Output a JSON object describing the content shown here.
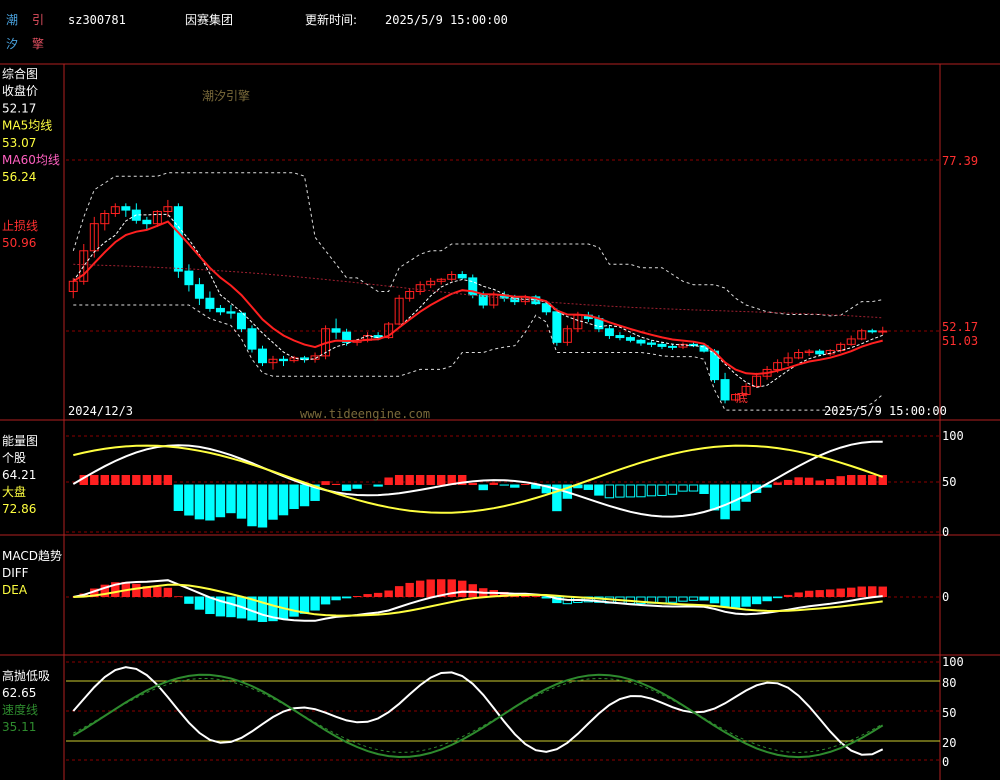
{
  "logo": {
    "chars": [
      "潮",
      "引",
      "汐",
      "擎"
    ],
    "colors": [
      "#4aa3df",
      "#e05060",
      "#4aa3df",
      "#e05060"
    ]
  },
  "header": {
    "code": "sz300781",
    "name": "因赛集团",
    "update_label": "更新时间:",
    "update_time": "2025/5/9 15:00:00"
  },
  "watermark": {
    "text1": "潮汐引擎",
    "text2": "www.tideengine.com"
  },
  "colors": {
    "up": "#ff2020",
    "down": "#00ffff",
    "ma5": "#ffffff",
    "ma60": "#ff2020",
    "grid": "#8b0000",
    "yellow": "#ffff40",
    "green": "#2e8b2e",
    "panel_border": "#b02020"
  },
  "panel1": {
    "labels": [
      {
        "t": "综合图",
        "c": "#ffffff"
      },
      {
        "t": "收盘价",
        "c": "#ffffff"
      },
      {
        "t": "52.17",
        "c": "#ffffff"
      },
      {
        "t": "MA5均线",
        "c": "#ffff40"
      },
      {
        "t": "53.07",
        "c": "#ffff40"
      },
      {
        "t": "MA60均线",
        "c": "#ff60c0"
      },
      {
        "t": "56.24",
        "c": "#ffff40"
      },
      {
        "t": "止损线",
        "c": "#ff3030"
      },
      {
        "t": "50.96",
        "c": "#ff3030"
      }
    ],
    "right_axis": {
      "high": "77.39",
      "close": "52.17",
      "stop": "51.03"
    },
    "start_date": "2024/12/3",
    "end_date": "2025/5/9  15:00:00",
    "bottom_mark": "底"
  },
  "panel2": {
    "labels": [
      {
        "t": "能量图",
        "c": "#ffffff"
      },
      {
        "t": "个股",
        "c": "#ffffff"
      },
      {
        "t": "64.21",
        "c": "#ffffff"
      },
      {
        "t": "大盘",
        "c": "#ffff40"
      },
      {
        "t": "72.86",
        "c": "#ffff40"
      }
    ],
    "ticks": [
      "100",
      "50",
      "0"
    ]
  },
  "panel3": {
    "labels": [
      {
        "t": "MACD趋势",
        "c": "#ffffff"
      },
      {
        "t": "DIFF",
        "c": "#ffffff"
      },
      {
        "t": "DEA",
        "c": "#ffff40"
      }
    ],
    "ticks": [
      "0"
    ]
  },
  "panel4": {
    "labels": [
      {
        "t": "高抛低吸",
        "c": "#ffffff"
      },
      {
        "t": "62.65",
        "c": "#ffffff"
      },
      {
        "t": "速度线",
        "c": "#2e8b2e"
      },
      {
        "t": "35.11",
        "c": "#2e8b2e"
      }
    ],
    "ticks": [
      "100",
      "80",
      "50",
      "20",
      "0"
    ]
  },
  "chart_data": {
    "type": "candlestick",
    "symbol": "sz300781",
    "date_range": [
      "2024/12/3",
      "2025/5/9"
    ],
    "price_axis": {
      "marks": [
        77.39,
        52.17,
        51.03
      ]
    },
    "candles_approx": [
      [
        58,
        60,
        57,
        59.5
      ],
      [
        59.5,
        65,
        59,
        64
      ],
      [
        64,
        69,
        63,
        68
      ],
      [
        68,
        70,
        67,
        69.5
      ],
      [
        69.5,
        71,
        69,
        70.5
      ],
      [
        70.5,
        71,
        69,
        70
      ],
      [
        70,
        71,
        68,
        68.5
      ],
      [
        68.5,
        69,
        67,
        68
      ],
      [
        68,
        70,
        67.5,
        69.8
      ],
      [
        69.8,
        71.5,
        69,
        70.5
      ],
      [
        70.5,
        71,
        60,
        61
      ],
      [
        61,
        62,
        58,
        59
      ],
      [
        59,
        60,
        56,
        57
      ],
      [
        57,
        58,
        55,
        55.5
      ],
      [
        55.5,
        56,
        54.5,
        55
      ],
      [
        55,
        56,
        54,
        54.8
      ],
      [
        54.8,
        55,
        52,
        52.5
      ],
      [
        52.5,
        53,
        49,
        49.5
      ],
      [
        49.5,
        50,
        47,
        47.5
      ],
      [
        47.5,
        48.5,
        46.5,
        48
      ],
      [
        48,
        48.5,
        47,
        47.8
      ],
      [
        47.8,
        48.5,
        47.5,
        48.2
      ],
      [
        48.2,
        48.5,
        47.5,
        48
      ],
      [
        48,
        49,
        47.5,
        48.5
      ],
      [
        48.5,
        53,
        48,
        52.5
      ],
      [
        52.5,
        54,
        51,
        52
      ],
      [
        52,
        52.5,
        50,
        50.5
      ],
      [
        50.5,
        51,
        50,
        50.8
      ],
      [
        50.8,
        52,
        50.5,
        51.5
      ],
      [
        51.5,
        52,
        50.8,
        51.2
      ],
      [
        51.2,
        53.5,
        51,
        53.2
      ],
      [
        53.2,
        57.5,
        53,
        57
      ],
      [
        57,
        58.5,
        56.5,
        58
      ],
      [
        58,
        59.5,
        57.5,
        59
      ],
      [
        59,
        60,
        58.5,
        59.5
      ],
      [
        59.5,
        60,
        59,
        59.8
      ],
      [
        59.8,
        61,
        59.5,
        60.5
      ],
      [
        60.5,
        61,
        59.8,
        60
      ],
      [
        60,
        60.5,
        57,
        57.5
      ],
      [
        57.5,
        58,
        55.5,
        56
      ],
      [
        56,
        58,
        55.5,
        57.5
      ],
      [
        57.5,
        58,
        56.5,
        57
      ],
      [
        57,
        57.5,
        56,
        56.5
      ],
      [
        56.5,
        57.5,
        56,
        57.2
      ],
      [
        57.2,
        57.5,
        56,
        56.2
      ],
      [
        56.2,
        56.5,
        54.5,
        55
      ],
      [
        55,
        55.5,
        50,
        50.5
      ],
      [
        50.5,
        53,
        50,
        52.5
      ],
      [
        52.5,
        55,
        52,
        54.5
      ],
      [
        54.5,
        55,
        53.5,
        54
      ],
      [
        54,
        54.5,
        52,
        52.5
      ],
      [
        52.5,
        53,
        51,
        51.5
      ],
      [
        51.5,
        52,
        50.8,
        51.2
      ],
      [
        51.2,
        51.5,
        50.5,
        50.8
      ],
      [
        50.8,
        51,
        50,
        50.4
      ],
      [
        50.4,
        50.8,
        49.8,
        50.2
      ],
      [
        50.2,
        50.5,
        49.5,
        49.9
      ],
      [
        49.9,
        50.3,
        49.4,
        49.8
      ],
      [
        49.8,
        50.5,
        49.5,
        50.2
      ],
      [
        50.2,
        50.6,
        49.8,
        50
      ],
      [
        50,
        50.4,
        49,
        49.2
      ],
      [
        49.2,
        49.5,
        44.5,
        45
      ],
      [
        45,
        46,
        41.5,
        42
      ],
      [
        42,
        43,
        41.8,
        42.8
      ],
      [
        42.8,
        44.5,
        42.5,
        44
      ],
      [
        44,
        46,
        43.8,
        45.5
      ],
      [
        45.5,
        47,
        45,
        46.5
      ],
      [
        46.5,
        48,
        46,
        47.5
      ],
      [
        47.5,
        49,
        47,
        48.2
      ],
      [
        48.2,
        49.5,
        48,
        49
      ],
      [
        49,
        49.5,
        48.5,
        49.2
      ],
      [
        49.2,
        49.5,
        48.5,
        48.8
      ],
      [
        48.8,
        49.5,
        48.5,
        49.3
      ],
      [
        49.3,
        50.5,
        49,
        50.2
      ],
      [
        50.2,
        51.5,
        50,
        51
      ],
      [
        51,
        52.5,
        50.8,
        52.2
      ],
      [
        52.2,
        52.5,
        51.8,
        52.1
      ],
      [
        52.1,
        52.8,
        51.6,
        52.17
      ]
    ],
    "series": [
      {
        "name": "MA5均线",
        "last": 53.07
      },
      {
        "name": "MA60均线",
        "last": 56.24
      },
      {
        "name": "止损线",
        "last": 50.96
      }
    ],
    "energy": {
      "个股": 64.21,
      "大盘": 72.86,
      "ylim": [
        0,
        100
      ]
    },
    "macd": {
      "names": [
        "DIFF",
        "DEA"
      ]
    },
    "gaopao": {
      "高抛低吸": 62.65,
      "速度线": 35.11,
      "ylim": [
        0,
        100
      ],
      "levels": [
        20,
        50,
        80
      ]
    }
  }
}
